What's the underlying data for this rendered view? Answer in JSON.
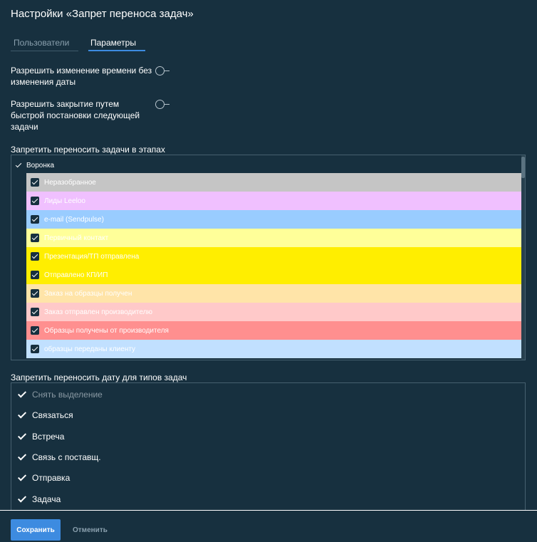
{
  "header": {
    "title": "Настройки «Запрет переноса задач»"
  },
  "tabs": [
    {
      "label": "Пользователи",
      "active": false
    },
    {
      "label": "Параметры",
      "active": true
    }
  ],
  "options": [
    {
      "label": "Разрешить изменение времени без изменения даты",
      "enabled": false
    },
    {
      "label": "Разрешить закрытие путем быстрой постановки следующей задачи",
      "enabled": false
    }
  ],
  "pipeline_section": {
    "label": "Запретить переносить задачи в этапах",
    "pipeline_name": "Воронка",
    "stages": [
      {
        "label": "Неразобранное",
        "color": "#c5c5c5",
        "checked": true
      },
      {
        "label": "Лиды Leeloo",
        "color": "#f0c0ff",
        "checked": true
      },
      {
        "label": "e-mail (Sendpulse)",
        "color": "#99ccff",
        "checked": true
      },
      {
        "label": "Первичный контакт",
        "color": "#ffff99",
        "checked": true
      },
      {
        "label": "Презентация/ТП отправлена",
        "color": "#ffee00",
        "checked": true
      },
      {
        "label": "Отправлено КП/ИП",
        "color": "#ffee00",
        "checked": true
      },
      {
        "label": "Заказ на образцы получен",
        "color": "#ffe4a8",
        "checked": true
      },
      {
        "label": "Заказ отправлен производителю",
        "color": "#ffc9c9",
        "checked": true
      },
      {
        "label": "Образцы получены от производителя",
        "color": "#ff8f8f",
        "checked": true
      },
      {
        "label": "образцы переданы клиенту",
        "color": "#c1e0ff",
        "checked": true
      }
    ]
  },
  "types_section": {
    "label": "Запретить переносить дату для типов задач",
    "items": [
      {
        "label": "Снять выделение",
        "muted": true
      },
      {
        "label": "Связаться",
        "muted": false
      },
      {
        "label": "Встреча",
        "muted": false
      },
      {
        "label": "Связь с поставщ.",
        "muted": false
      },
      {
        "label": "Отправка",
        "muted": false
      },
      {
        "label": "Задача",
        "muted": false
      }
    ]
  },
  "footer": {
    "save_label": "Сохранить",
    "cancel_label": "Отменить"
  },
  "colors": {
    "background": "#17303f",
    "accent": "#3d8be0"
  }
}
